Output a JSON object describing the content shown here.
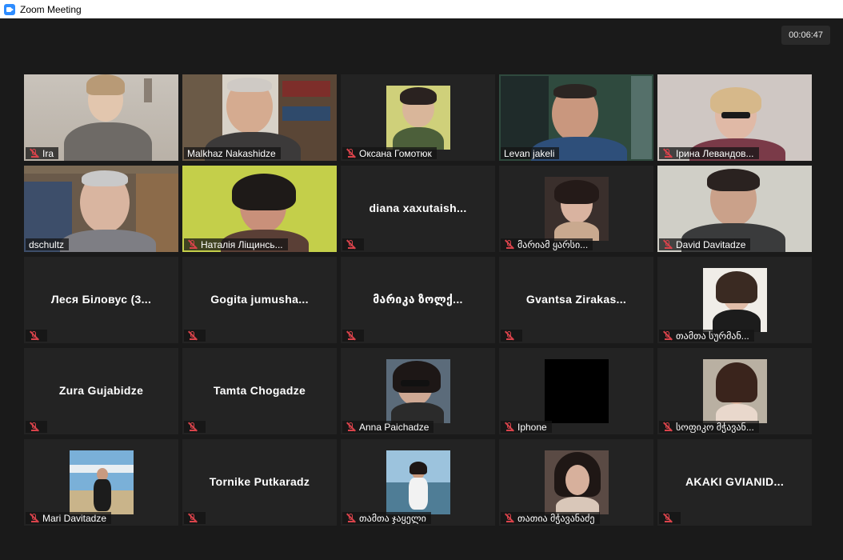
{
  "window": {
    "title": "Zoom Meeting"
  },
  "meeting": {
    "timer": "00:06:47"
  },
  "colors": {
    "muted_icon": "#d9434b",
    "active_speaker_border": "#e6e84c",
    "zoom_blue": "#2d8cff"
  },
  "participants": [
    {
      "label": "Ira",
      "muted": true,
      "video": "full"
    },
    {
      "label": "Malkhaz Nakashidze",
      "muted": false,
      "video": "full"
    },
    {
      "label": "Оксана Гомотюк",
      "muted": true,
      "video": "small"
    },
    {
      "label": "Levan jakeli",
      "muted": false,
      "video": "full",
      "active_speaker": true
    },
    {
      "label": "Ірина Левандов...",
      "muted": true,
      "video": "full"
    },
    {
      "label": "dschultz",
      "muted": false,
      "video": "full"
    },
    {
      "label": "Наталія Ліщинсь...",
      "muted": true,
      "video": "full"
    },
    {
      "label": "",
      "display_name": "diana  xaxutaish...",
      "muted": true,
      "video": "none"
    },
    {
      "label": "მარიამ ყარსი...",
      "muted": true,
      "video": "small"
    },
    {
      "label": "David Davitadze",
      "muted": true,
      "video": "full"
    },
    {
      "label": "",
      "display_name": "Леся Біловус (3...",
      "muted": true,
      "video": "none"
    },
    {
      "label": "",
      "display_name": "Gogita  jumusha...",
      "muted": true,
      "video": "none"
    },
    {
      "label": "",
      "display_name": "მარიკა  ზოლქ...",
      "muted": true,
      "video": "none"
    },
    {
      "label": "",
      "display_name": "Gvantsa  Zirakas...",
      "muted": true,
      "video": "none"
    },
    {
      "label": "თამთა სურმან...",
      "muted": true,
      "video": "small"
    },
    {
      "label": "",
      "display_name": "Zura Gujabidze",
      "muted": true,
      "video": "none"
    },
    {
      "label": "",
      "display_name": "Tamta Chogadze",
      "muted": true,
      "video": "none"
    },
    {
      "label": "Anna Paichadze",
      "muted": true,
      "video": "small"
    },
    {
      "label": "Iphone",
      "muted": true,
      "video": "small-black"
    },
    {
      "label": "სოფიკო მჭავან...",
      "muted": true,
      "video": "small"
    },
    {
      "label": "Mari Davitadze",
      "muted": true,
      "video": "small"
    },
    {
      "label": "",
      "display_name": "Tornike Putkaradz",
      "muted": true,
      "video": "none"
    },
    {
      "label": "თამთა ჯაყელი",
      "muted": true,
      "video": "small"
    },
    {
      "label": "თათია მჭავანაძე",
      "muted": true,
      "video": "small"
    },
    {
      "label": "",
      "display_name": "AKAKI GVIANID...",
      "muted": true,
      "video": "none"
    }
  ]
}
